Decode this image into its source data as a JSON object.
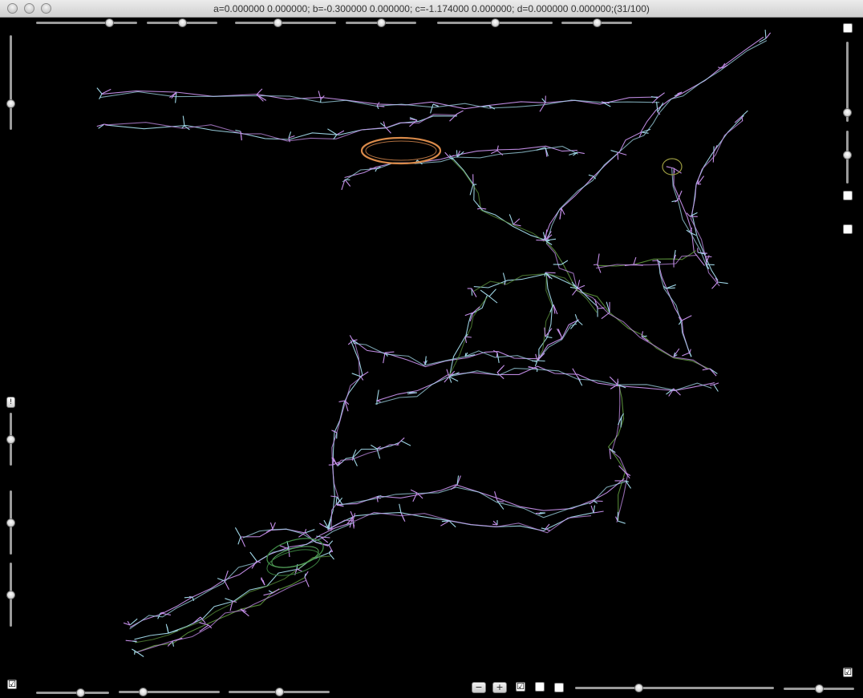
{
  "window": {
    "title": "a=0.000000 0.000000; b=-0.300000 0.000000; c=-1.174000 0.000000; d=0.000000 0.000000;(31/100)"
  },
  "top_sliders": [
    0.72,
    0.5,
    0.42,
    0.5,
    0.5,
    0.5
  ],
  "left_sliders": [
    0.72,
    0.5,
    0.5,
    0.5
  ],
  "right_sliders": [
    0.88,
    0.45
  ],
  "bottom_left_sliders": [
    0.6,
    0.24,
    0.5
  ],
  "bottom_right_sliders": [
    0.32,
    0.5
  ],
  "bottom_controls": {
    "minus_label": "−",
    "plus_label": "+",
    "checkbox_1": "☑",
    "checkbox_2": "",
    "checkbox_3": ""
  },
  "side_checkboxes": {
    "bottom_left": "☑",
    "bottom_right": "☑",
    "right_1": "",
    "right_2": "",
    "right_3": ""
  },
  "left_small_button_label": "!",
  "colors": {
    "background": "#000000",
    "fractal_lavender": "#c48ee8",
    "fractal_cyan": "#9fd6e6",
    "fractal_orange": "#d98a4a",
    "fractal_green": "#5a8f3a",
    "fractal_olive": "#9a9a40"
  }
}
